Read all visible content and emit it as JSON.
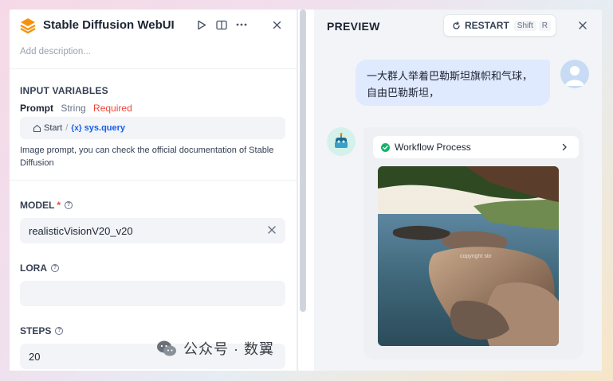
{
  "app": {
    "title": "Stable Diffusion WebUI",
    "description_placeholder": "Add description..."
  },
  "input_variables": {
    "section_title": "INPUT VARIABLES",
    "prompt": {
      "name": "Prompt",
      "type": "String",
      "required": "Required",
      "source_node": "Start",
      "separator": "/",
      "variable_icon": "{x}",
      "variable": "sys.query",
      "help": "Image prompt, you can check the official documentation of Stable Diffusion"
    }
  },
  "fields": {
    "model": {
      "label": "MODEL",
      "required_mark": "*",
      "value": "realisticVisionV20_v20"
    },
    "lora": {
      "label": "LORA",
      "value": ""
    },
    "steps": {
      "label": "STEPS",
      "value": "20"
    }
  },
  "preview": {
    "title": "PREVIEW",
    "restart_label": "RESTART",
    "shortcut_mod": "Shift",
    "shortcut_key": "R",
    "user_message": "一大群人举着巴勒斯坦旗帜和气球，自由巴勒斯坦，",
    "workflow_label": "Workflow Process",
    "image_watermark": "copyright stir"
  },
  "overlay": {
    "watermark": "公众号 · 数翼"
  },
  "colors": {
    "accent": "#155eef",
    "required": "#f04438",
    "success": "#17b26a",
    "user_bubble": "#e0eafe"
  }
}
